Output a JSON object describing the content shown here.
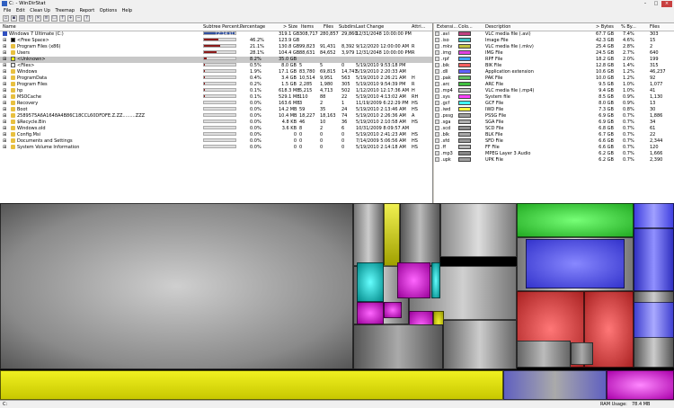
{
  "window": {
    "title": "C: - WinDirStat"
  },
  "menu": [
    "File",
    "Edit",
    "Clean Up",
    "Treemap",
    "Report",
    "Options",
    "Help"
  ],
  "dir_headers": [
    "Name",
    "Subtree Percent...",
    "Percentage",
    "> Size",
    "Items",
    "Files",
    "Subdirs",
    "Last Change",
    "Attri..."
  ],
  "dir_rows": [
    {
      "name": "Windows 7 Ultimate (C:)",
      "subtree": "[2:14 s]",
      "pct": "",
      "size": "319.1 GB",
      "items": "308,717",
      "files": "280,857",
      "subdirs": "29,860",
      "last": "12/31/2048 10:00:00 PM",
      "attr": "",
      "fill": 0.98,
      "icon": "drive",
      "icon_color": "#3050c0"
    },
    {
      "name": "<Free Space>",
      "subtree": "",
      "pct": "46.2%",
      "size": "123.9 GB",
      "items": "",
      "files": "",
      "subdirs": "",
      "last": "",
      "attr": "",
      "fill": 0.462,
      "icon": "square",
      "icon_color": "#000000"
    },
    {
      "name": "Program Files (x86)",
      "subtree": "",
      "pct": "21.1%",
      "size": "130.8 GB",
      "items": "99,823",
      "files": "91,431",
      "subdirs": "8,392",
      "last": "9/12/2020 12:00:00 AM",
      "attr": "R",
      "fill": 0.5,
      "icon": "folder",
      "icon_color": "#e8c040"
    },
    {
      "name": "Users",
      "subtree": "",
      "pct": "28.1%",
      "size": "104.4 GB",
      "items": "88,631",
      "files": "84,652",
      "subdirs": "3,979",
      "last": "12/31/2048 10:00:00 PM",
      "attr": "R",
      "fill": 0.4,
      "icon": "folder",
      "icon_color": "#e8c040"
    },
    {
      "name": "<Unknown>",
      "subtree": "",
      "pct": "8.2%",
      "size": "35.0 GB",
      "items": "",
      "files": "",
      "subdirs": "",
      "last": "",
      "attr": "",
      "fill": 0.08,
      "icon": "square",
      "icon_color": "#ffff00"
    },
    {
      "name": "<Files>",
      "subtree": "",
      "pct": "0.5%",
      "size": "8.0 GB",
      "items": "5",
      "files": "5",
      "subdirs": "0",
      "last": "5/19/2010 9:53:18 PM",
      "attr": "",
      "fill": 0.02,
      "icon": "square",
      "icon_color": "#ffffff"
    },
    {
      "name": "Windows",
      "subtree": "",
      "pct": "1.9%",
      "size": "17.1 GB",
      "items": "83,780",
      "files": "69,815",
      "subdirs": "14,741",
      "last": "5/19/2010 2:20:33 AM",
      "attr": "",
      "fill": 0.02,
      "icon": "folder",
      "icon_color": "#e8c040"
    },
    {
      "name": "ProgramData",
      "subtree": "",
      "pct": "0.4%",
      "size": "3.4 GB",
      "items": "10,514",
      "files": "9,951",
      "subdirs": "563",
      "last": "5/19/2010 2:26:21 AM",
      "attr": "H",
      "fill": 0.01,
      "icon": "folder",
      "icon_color": "#e8c040"
    },
    {
      "name": "Program Files",
      "subtree": "",
      "pct": "0.2%",
      "size": "1.5 GB",
      "items": "2,285",
      "files": "1,980",
      "subdirs": "305",
      "last": "5/19/2010 9:54:39 PM",
      "attr": "R",
      "fill": 0.01,
      "icon": "folder",
      "icon_color": "#e8c040"
    },
    {
      "name": "hp",
      "subtree": "",
      "pct": "0.1%",
      "size": "618.3 MB",
      "items": "5,215",
      "files": "4,713",
      "subdirs": "502",
      "last": "1/12/2010 12:17:36 AM",
      "attr": "H",
      "fill": 0.005,
      "icon": "folder",
      "icon_color": "#e8c040"
    },
    {
      "name": "MSOCache",
      "subtree": "",
      "pct": "0.1%",
      "size": "529.1 MB",
      "items": "110",
      "files": "88",
      "subdirs": "22",
      "last": "5/19/2010 4:13:02 AM",
      "attr": "RH",
      "fill": 0.005,
      "icon": "folder",
      "icon_color": "#e8c040"
    },
    {
      "name": "Recovery",
      "subtree": "",
      "pct": "0.0%",
      "size": "163.6 MB",
      "items": "3",
      "files": "2",
      "subdirs": "1",
      "last": "11/19/2009 6:22:29 PM",
      "attr": "HS",
      "fill": 0.002,
      "icon": "folder",
      "icon_color": "#e8c040"
    },
    {
      "name": "Boot",
      "subtree": "",
      "pct": "0.0%",
      "size": "14.2 MB",
      "items": "59",
      "files": "35",
      "subdirs": "24",
      "last": "5/19/2010 2:13:46 AM",
      "attr": "HS",
      "fill": 0.001,
      "icon": "folder",
      "icon_color": "#e8c040"
    },
    {
      "name": "2589575A6A1648A4B86C18CCL60DFDFE.Z.ZZ.........ZZZ",
      "subtree": "",
      "pct": "0.0%",
      "size": "10.4 MB",
      "items": "18,227",
      "files": "18,163",
      "subdirs": "74",
      "last": "5/19/2010 2:26:36 AM",
      "attr": "A",
      "fill": 0.001,
      "icon": "folder",
      "icon_color": "#e8c040"
    },
    {
      "name": "$Recycle.Bin",
      "subtree": "",
      "pct": "0.0%",
      "size": "4.8 KB",
      "items": "46",
      "files": "10",
      "subdirs": "36",
      "last": "5/19/2010 2:10:58 AM",
      "attr": "HS",
      "fill": 0.0,
      "icon": "folder",
      "icon_color": "#e8c040"
    },
    {
      "name": "Windows.old",
      "subtree": "",
      "pct": "0.0%",
      "size": "3.6 KB",
      "items": "8",
      "files": "2",
      "subdirs": "6",
      "last": "10/31/2009 8:09:57 AM",
      "attr": "",
      "fill": 0.0,
      "icon": "folder",
      "icon_color": "#e8c040"
    },
    {
      "name": "Config.Msi",
      "subtree": "",
      "pct": "0.0%",
      "size": "0",
      "items": "0",
      "files": "0",
      "subdirs": "0",
      "last": "5/19/2010 2:41:23 AM",
      "attr": "HS",
      "fill": 0.0,
      "icon": "folder",
      "icon_color": "#e8c040"
    },
    {
      "name": "Documents and Settings",
      "subtree": "",
      "pct": "0.0%",
      "size": "0",
      "items": "0",
      "files": "0",
      "subdirs": "0",
      "last": "7/14/2009 5:06:56 AM",
      "attr": "HS",
      "fill": 0.0,
      "icon": "folder",
      "icon_color": "#e8c040"
    },
    {
      "name": "System Volume Information",
      "subtree": "",
      "pct": "0.0%",
      "size": "0",
      "items": "0",
      "files": "0",
      "subdirs": "0",
      "last": "5/19/2010 2:14:18 AM",
      "attr": "HS",
      "fill": 0.0,
      "icon": "folder",
      "icon_color": "#e8c040"
    }
  ],
  "ext_headers": [
    "Extensi...",
    "Colo...",
    "Description",
    "> Bytes",
    "% By...",
    "Files"
  ],
  "ext_rows": [
    {
      "ext": ".avi",
      "color": "#c04080",
      "desc": "VLC media file (.avi)",
      "bytes": "67.7 GB",
      "pct": "7.4%",
      "files": "303"
    },
    {
      "ext": ".iso",
      "color": "#40c0c0",
      "desc": "Image File",
      "bytes": "42.3 GB",
      "pct": "4.6%",
      "files": "15"
    },
    {
      "ext": ".mkv",
      "color": "#c0c040",
      "desc": "VLC media file (.mkv)",
      "bytes": "25.4 GB",
      "pct": "2.8%",
      "files": "2"
    },
    {
      "ext": ".img",
      "color": "#e040e0",
      "desc": "IMG File",
      "bytes": "24.5 GB",
      "pct": "2.7%",
      "files": "640"
    },
    {
      "ext": ".rpf",
      "color": "#40a0ff",
      "desc": "RPF File",
      "bytes": "18.2 GB",
      "pct": "2.0%",
      "files": "199"
    },
    {
      "ext": ".bik",
      "color": "#ff6060",
      "desc": "BIK File",
      "bytes": "12.8 GB",
      "pct": "1.4%",
      "files": "315"
    },
    {
      "ext": ".dll",
      "color": "#6060ff",
      "desc": "Application extension",
      "bytes": "10.6 GB",
      "pct": "1.2%",
      "files": "46,237"
    },
    {
      "ext": ".pak",
      "color": "#60c060",
      "desc": "PAK File",
      "bytes": "10.0 GB",
      "pct": "1.2%",
      "files": "92"
    },
    {
      "ext": ".arc",
      "color": "#40c040",
      "desc": "ARC File",
      "bytes": "9.5 GB",
      "pct": "1.0%",
      "files": "1,077"
    },
    {
      "ext": ".mp4",
      "color": "#c0c0c0",
      "desc": "VLC media file (.mp4)",
      "bytes": "9.4 GB",
      "pct": "1.0%",
      "files": "41"
    },
    {
      "ext": ".sys",
      "color": "#ff40ff",
      "desc": "System file",
      "bytes": "8.5 GB",
      "pct": "0.9%",
      "files": "1,130"
    },
    {
      "ext": ".gcf",
      "color": "#40ffff",
      "desc": "GCF File",
      "bytes": "8.0 GB",
      "pct": "0.9%",
      "files": "13"
    },
    {
      "ext": ".iwd",
      "color": "#ffff40",
      "desc": "IWD File",
      "bytes": "7.3 GB",
      "pct": "0.8%",
      "files": "30"
    },
    {
      "ext": ".pssg",
      "color": "#a0a0a0",
      "desc": "PSSG File",
      "bytes": "6.9 GB",
      "pct": "0.7%",
      "files": "1,886"
    },
    {
      "ext": ".sga",
      "color": "#b0b0b0",
      "desc": "SGA File",
      "bytes": "6.9 GB",
      "pct": "0.7%",
      "files": "34"
    },
    {
      "ext": ".scd",
      "color": "#909090",
      "desc": "SCD File",
      "bytes": "6.8 GB",
      "pct": "0.7%",
      "files": "61"
    },
    {
      "ext": ".blk",
      "color": "#a8a8a8",
      "desc": "BLK File",
      "bytes": "6.7 GB",
      "pct": "0.7%",
      "files": "22"
    },
    {
      "ext": ".sfd",
      "color": "#989898",
      "desc": "SFD File",
      "bytes": "6.6 GB",
      "pct": "0.7%",
      "files": "2,344"
    },
    {
      "ext": ".ff",
      "color": "#b8b8b8",
      "desc": "FF File",
      "bytes": "6.6 GB",
      "pct": "0.7%",
      "files": "120"
    },
    {
      "ext": ".mp3",
      "color": "#888888",
      "desc": "MPEG Layer 3 Audio",
      "bytes": "6.2 GB",
      "pct": "0.7%",
      "files": "1,666"
    },
    {
      "ext": ".upk",
      "color": "#a0a0a0",
      "desc": "UPK File",
      "bytes": "6.2 GB",
      "pct": "0.7%",
      "files": "2,390"
    }
  ],
  "status": {
    "left": "C:",
    "ram_label": "RAM Usage:",
    "ram_value": "78.4 MB"
  },
  "colors": {
    "accent": "#8b1a1a",
    "selection": "#c8c8c8"
  }
}
